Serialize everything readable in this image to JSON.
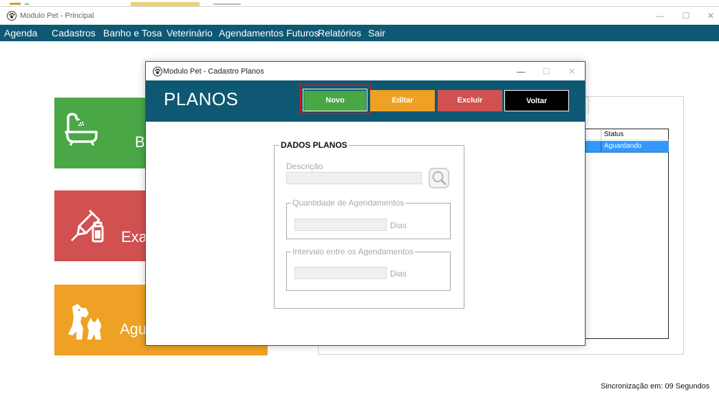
{
  "app": {
    "main_title": "Modulo Pet - Principal",
    "menu": [
      "Agenda",
      "Cadastros",
      "Banho e Tosa",
      "Veterinário",
      "Agendamentos Futuros",
      "Relatórios",
      "Sair"
    ],
    "window_controls": {
      "minimize": "—",
      "maximize": "☐",
      "close": "✕"
    },
    "tiles": [
      {
        "label": "B",
        "icon": "bathtub-shower-icon",
        "color": "#49a746"
      },
      {
        "label": "Exa",
        "icon": "syringe-vial-icon",
        "color": "#d05150"
      },
      {
        "label": "Agu",
        "icon": "dog-cat-icon",
        "color": "#eea124"
      }
    ],
    "grid": {
      "header": "Status",
      "rows": [
        "Aguardando"
      ],
      "selected_color": "#3399ff"
    },
    "sync_text": "Sincronização em: 09 Segundos"
  },
  "dialog": {
    "title": "Modulo Pet - Cadastro Planos",
    "heading": "PLANOS",
    "buttons": {
      "novo": "Novo",
      "editar": "Editar",
      "excluir": "Excluir",
      "voltar": "Voltar"
    },
    "button_colors": {
      "novo": "#49a746",
      "editar": "#eea124",
      "excluir": "#d05150",
      "voltar": "#000000"
    },
    "highlight_color": "#d01717",
    "group_title": "DADOS PLANOS",
    "descricao_label": "Descrição",
    "descricao_value": "",
    "search_icon": "magnifier-icon",
    "qtd_group": "Quantidade de Agendamentos",
    "qtd_value": "",
    "intervalo_group": "Intervalo entre os Agendamentos",
    "intervalo_value": "",
    "dias_label": "Dias"
  },
  "theme": {
    "header_bg": "#0f5873"
  }
}
